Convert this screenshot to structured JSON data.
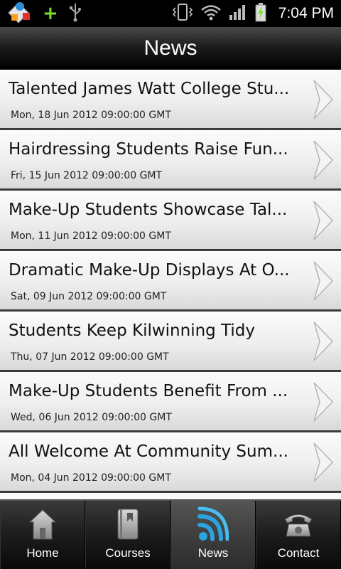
{
  "status_bar": {
    "time": "7:04 PM",
    "icons": [
      "app-logo-icon",
      "plus-icon",
      "usb-icon",
      "vibrate-icon",
      "wifi-icon",
      "signal-icon",
      "battery-charging-icon"
    ],
    "plus_glyph": "+"
  },
  "header": {
    "title": "News"
  },
  "news": [
    {
      "title": "Talented James Watt College Stu...",
      "date": "Mon, 18 Jun 2012 09:00:00 GMT"
    },
    {
      "title": "Hairdressing Students Raise Fun...",
      "date": "Fri, 15 Jun 2012 09:00:00 GMT"
    },
    {
      "title": "Make-Up Students Showcase Tal...",
      "date": "Mon, 11 Jun 2012 09:00:00 GMT"
    },
    {
      "title": "Dramatic Make-Up Displays At O...",
      "date": "Sat, 09 Jun 2012 09:00:00 GMT"
    },
    {
      "title": "Students Keep Kilwinning Tidy",
      "date": "Thu, 07 Jun 2012 09:00:00 GMT"
    },
    {
      "title": "Make-Up Students Benefit From ...",
      "date": "Wed, 06 Jun 2012 09:00:00 GMT"
    },
    {
      "title": "All Welcome At Community Sum...",
      "date": "Mon, 04 Jun 2012 09:00:00 GMT"
    }
  ],
  "tabs": [
    {
      "label": "Home",
      "icon": "home-icon",
      "active": false
    },
    {
      "label": "Courses",
      "icon": "book-icon",
      "active": false
    },
    {
      "label": "News",
      "icon": "rss-icon",
      "active": true
    },
    {
      "label": "Contact",
      "icon": "phone-icon",
      "active": false
    }
  ],
  "colors": {
    "accent": "#2aa3e0",
    "plus": "#7be12a",
    "battery_bolt": "#7be12a"
  }
}
